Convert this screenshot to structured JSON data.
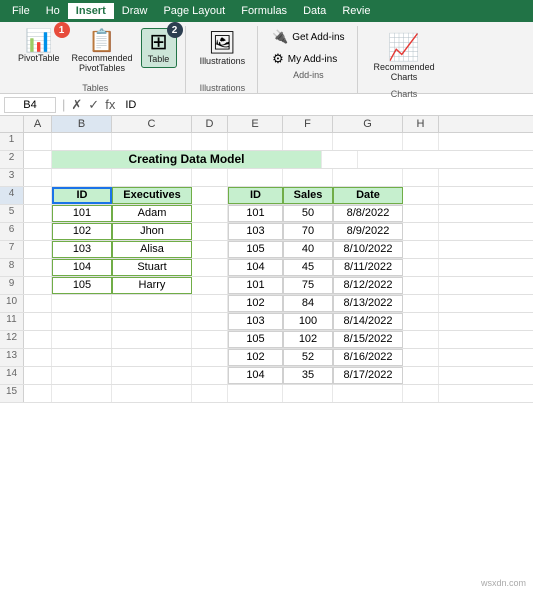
{
  "ribbon": {
    "tabs": [
      "File",
      "Ho",
      "Insert",
      "Draw",
      "Page Layout",
      "Formulas",
      "Data",
      "Revie"
    ],
    "active_tab": "Insert",
    "tables_group": {
      "label": "Tables",
      "buttons": [
        {
          "id": "pivot-table",
          "label": "PivotTable",
          "icon": "📊"
        },
        {
          "id": "recommended-pivottables",
          "label": "Recommended\nPivotTables",
          "icon": "📋"
        },
        {
          "id": "table",
          "label": "Table",
          "icon": "⊞",
          "active": true
        }
      ]
    },
    "illustrations_group": {
      "label": "Illustrations",
      "buttons": [
        {
          "id": "illustrations",
          "label": "Illustrations",
          "icon": "🖼"
        }
      ]
    },
    "addins_group": {
      "label": "Add-ins",
      "buttons": [
        {
          "id": "get-addins",
          "label": "Get Add-ins",
          "icon": "🔌"
        },
        {
          "id": "my-addins",
          "label": "My Add-ins",
          "icon": "⚙"
        }
      ]
    },
    "charts_group": {
      "label": "Charts",
      "buttons": [
        {
          "id": "recommended-charts",
          "label": "Recommended\nCharts",
          "icon": "📈"
        }
      ]
    },
    "badge1_label": "1",
    "badge2_label": "2"
  },
  "formula_bar": {
    "cell_ref": "B4",
    "formula": "ID"
  },
  "columns": [
    "A",
    "B",
    "C",
    "D",
    "E",
    "F",
    "G",
    "H"
  ],
  "title_row": {
    "row": 2,
    "text": "Creating Data Model",
    "col_span": "B-G"
  },
  "left_table": {
    "headers": [
      "ID",
      "Executives"
    ],
    "rows": [
      [
        "101",
        "Adam"
      ],
      [
        "102",
        "Jhon"
      ],
      [
        "103",
        "Alisa"
      ],
      [
        "104",
        "Stuart"
      ],
      [
        "105",
        "Harry"
      ]
    ]
  },
  "right_table": {
    "headers": [
      "ID",
      "Sales",
      "Date"
    ],
    "rows": [
      [
        "101",
        "50",
        "8/8/2022"
      ],
      [
        "103",
        "70",
        "8/9/2022"
      ],
      [
        "105",
        "40",
        "8/10/2022"
      ],
      [
        "104",
        "45",
        "8/11/2022"
      ],
      [
        "101",
        "75",
        "8/12/2022"
      ],
      [
        "102",
        "84",
        "8/13/2022"
      ],
      [
        "103",
        "100",
        "8/14/2022"
      ],
      [
        "105",
        "102",
        "8/15/2022"
      ],
      [
        "102",
        "52",
        "8/16/2022"
      ],
      [
        "104",
        "35",
        "8/17/2022"
      ]
    ]
  },
  "row_numbers": [
    "1",
    "2",
    "3",
    "4",
    "5",
    "6",
    "7",
    "8",
    "9",
    "10",
    "11",
    "12",
    "13",
    "14",
    "15"
  ],
  "watermark": "wsxdn.com"
}
